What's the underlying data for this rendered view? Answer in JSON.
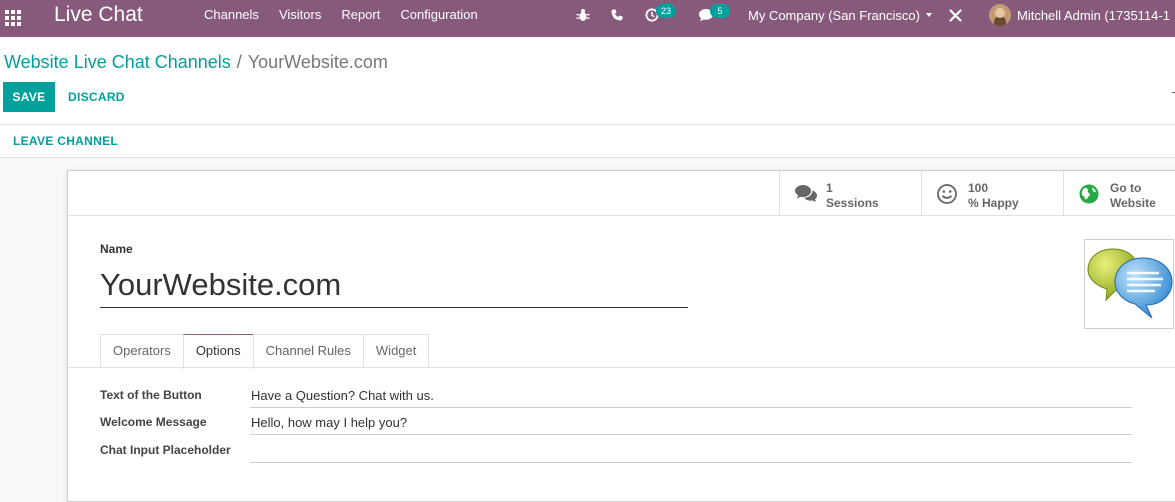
{
  "navbar": {
    "app_title": "Live Chat",
    "menu": [
      "Channels",
      "Visitors",
      "Report",
      "Configuration"
    ],
    "activity_count": "23",
    "message_count": "5",
    "company": "My Company (San Francisco)",
    "user": "Mitchell Admin (1735114-1"
  },
  "breadcrumb": {
    "parent": "Website Live Chat Channels",
    "separator": "/",
    "current": "YourWebsite.com"
  },
  "actions": {
    "save": "SAVE",
    "discard": "DISCARD",
    "leave_channel": "LEAVE CHANNEL"
  },
  "stat_buttons": [
    {
      "value": "1",
      "label": "Sessions",
      "icon": "comments-icon"
    },
    {
      "value": "100",
      "label": "% Happy",
      "icon": "smile-icon"
    },
    {
      "value": "Go to",
      "label": "Website",
      "icon": "globe-icon"
    }
  ],
  "form": {
    "name_label": "Name",
    "name_value": "YourWebsite.com",
    "tabs": [
      "Operators",
      "Options",
      "Channel Rules",
      "Widget"
    ],
    "active_tab": "Options",
    "fields": [
      {
        "label": "Text of the Button",
        "value": "Have a Question? Chat with us."
      },
      {
        "label": "Welcome Message",
        "value": "Hello, how may I help you?"
      },
      {
        "label": "Chat Input Placeholder",
        "value": ""
      }
    ]
  },
  "colors": {
    "navbar": "#875a7b",
    "accent": "#00a09d",
    "badge": "#00a09d"
  }
}
